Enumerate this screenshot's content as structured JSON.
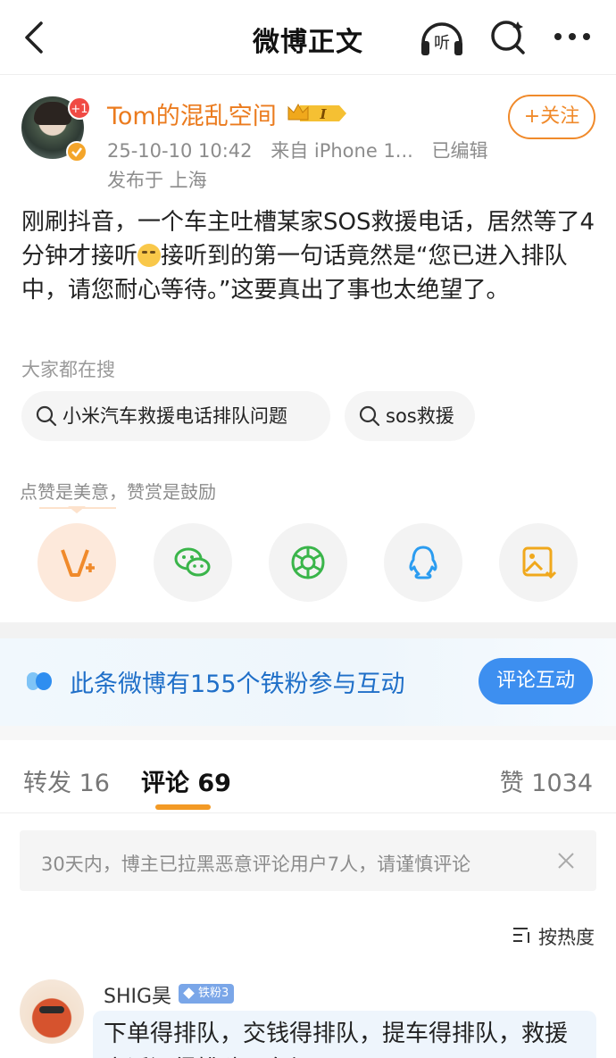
{
  "nav": {
    "title": "微博正文",
    "listen_label": "听",
    "icons": [
      "back-arrow-icon",
      "listen-headphones-icon",
      "search-icon",
      "more-icon"
    ]
  },
  "author": {
    "name": "Tom的混乱空间",
    "avatar_badge": "+1",
    "level_badge": "I",
    "time": "25-10-10 10:42",
    "source": "来自 iPhone 1...",
    "edited": "已编辑",
    "location": "发布于 上海",
    "follow_label": "+关注"
  },
  "post": {
    "text_part1": "刚刷抖音，一个车主吐槽某家SOS救援电话，居然等了4分钟才接听",
    "text_part2": "接听到的第一句话竟然是“您已进入排队中，请您耐心等待。”这要真出了事也太绝望了。"
  },
  "trending": {
    "label": "大家都在搜",
    "chips": [
      "小米汽车救援电话排队问题",
      "sos救援"
    ]
  },
  "reward": {
    "tip": "点赞是美意，赞赏是鼓励"
  },
  "share": [
    "v-plus-icon",
    "wechat-icon",
    "moments-icon",
    "qq-icon",
    "save-image-icon"
  ],
  "fans": {
    "text": "此条微博有155个铁粉参与互动",
    "button": "评论互动"
  },
  "tabs": {
    "repost": "转发 16",
    "comment": "评论 69",
    "like": "赞 1034"
  },
  "notice": {
    "text": "30天内，博主已拉黑恶意评论用户7人，请谨慎评论"
  },
  "sort": {
    "label": "按热度"
  },
  "comment": {
    "user": "SHIG昊",
    "badge": "铁粉3",
    "text": "下单得排队，交钱得排队，提车得排队，救援电话还得排队，车坏了"
  },
  "colors": {
    "accent_orange": "#eb7b1e",
    "fans_blue": "#1f6fc8",
    "button_blue": "#3d8ff0",
    "tab_indicator": "#f39a25"
  }
}
